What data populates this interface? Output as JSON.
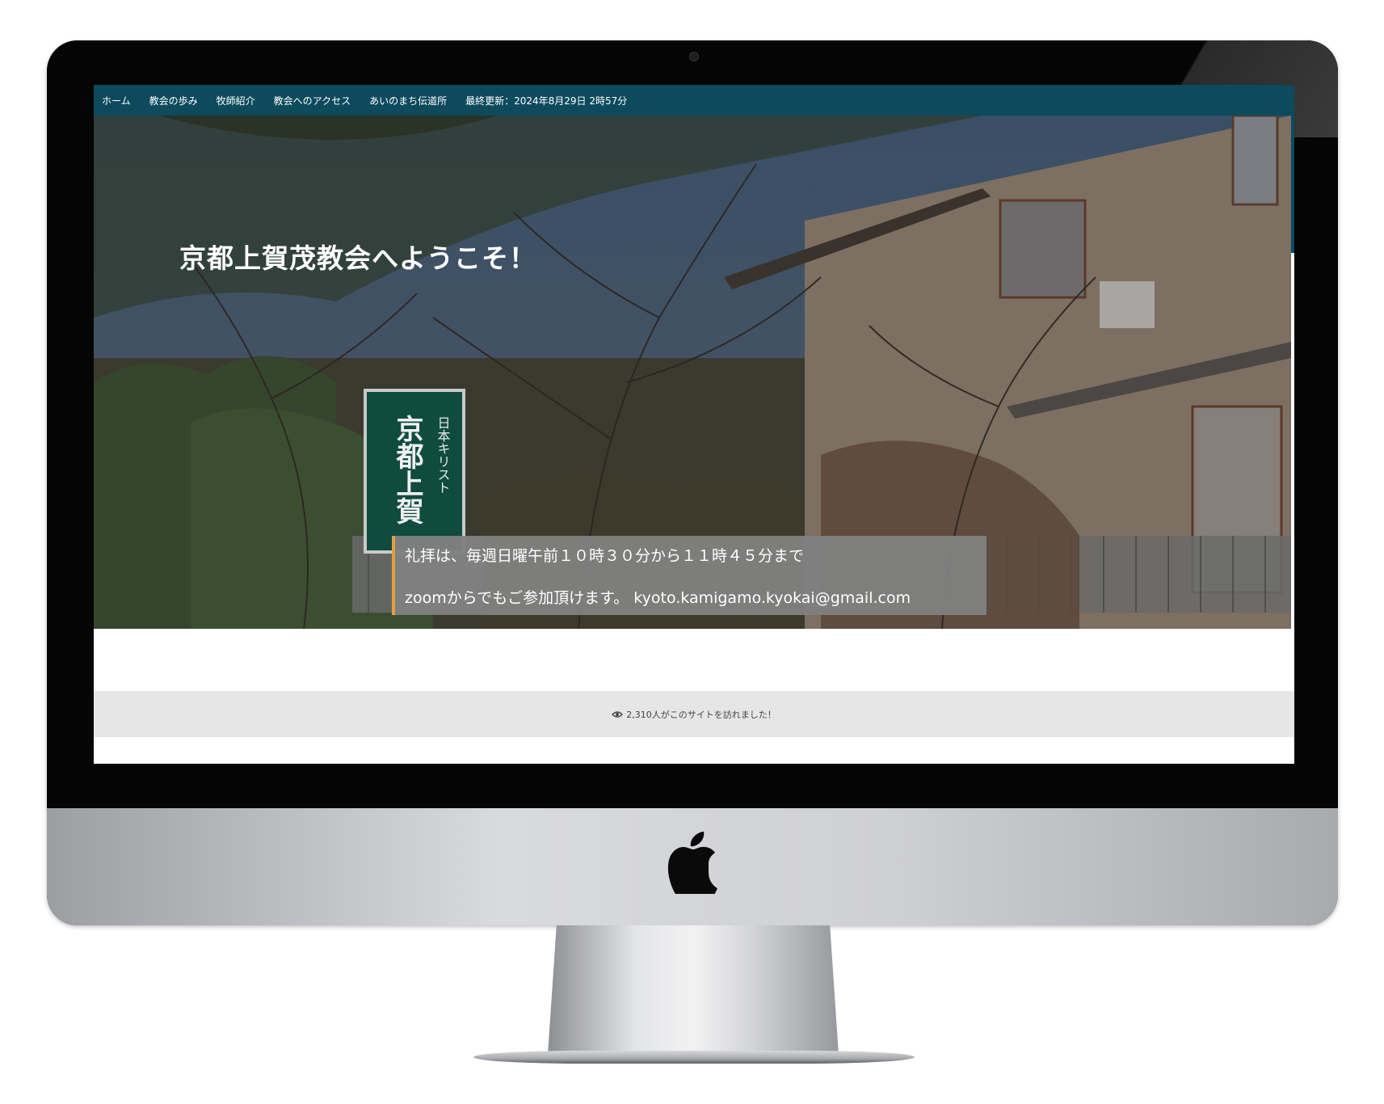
{
  "nav": {
    "items": [
      {
        "label": "ホーム"
      },
      {
        "label": "教会の歩み"
      },
      {
        "label": "牧師紹介"
      },
      {
        "label": "教会へのアクセス"
      },
      {
        "label": "あいのまち伝道所"
      }
    ],
    "last_updated": "最終更新：2024年8月29日 2時57分"
  },
  "hero": {
    "title": "京都上賀茂教会へようこそ！",
    "sign_text": "日本キリスト 京都上賀",
    "notice_line1": "礼拝は、毎週日曜午前１０時３０分から１１時４５分まで",
    "notice_line2": "zoomからでもご参加頂けます。 kyoto.kamigamo.kyokai@gmail.com"
  },
  "footer": {
    "visitor_text": "2,310人がこのサイトを訪れました！",
    "icon": "eye-icon"
  },
  "colors": {
    "nav_bg": "#0d4a5c",
    "notice_bg": "#808080",
    "notice_accent": "#e0a040",
    "footer_bg": "#e6e6e6"
  }
}
